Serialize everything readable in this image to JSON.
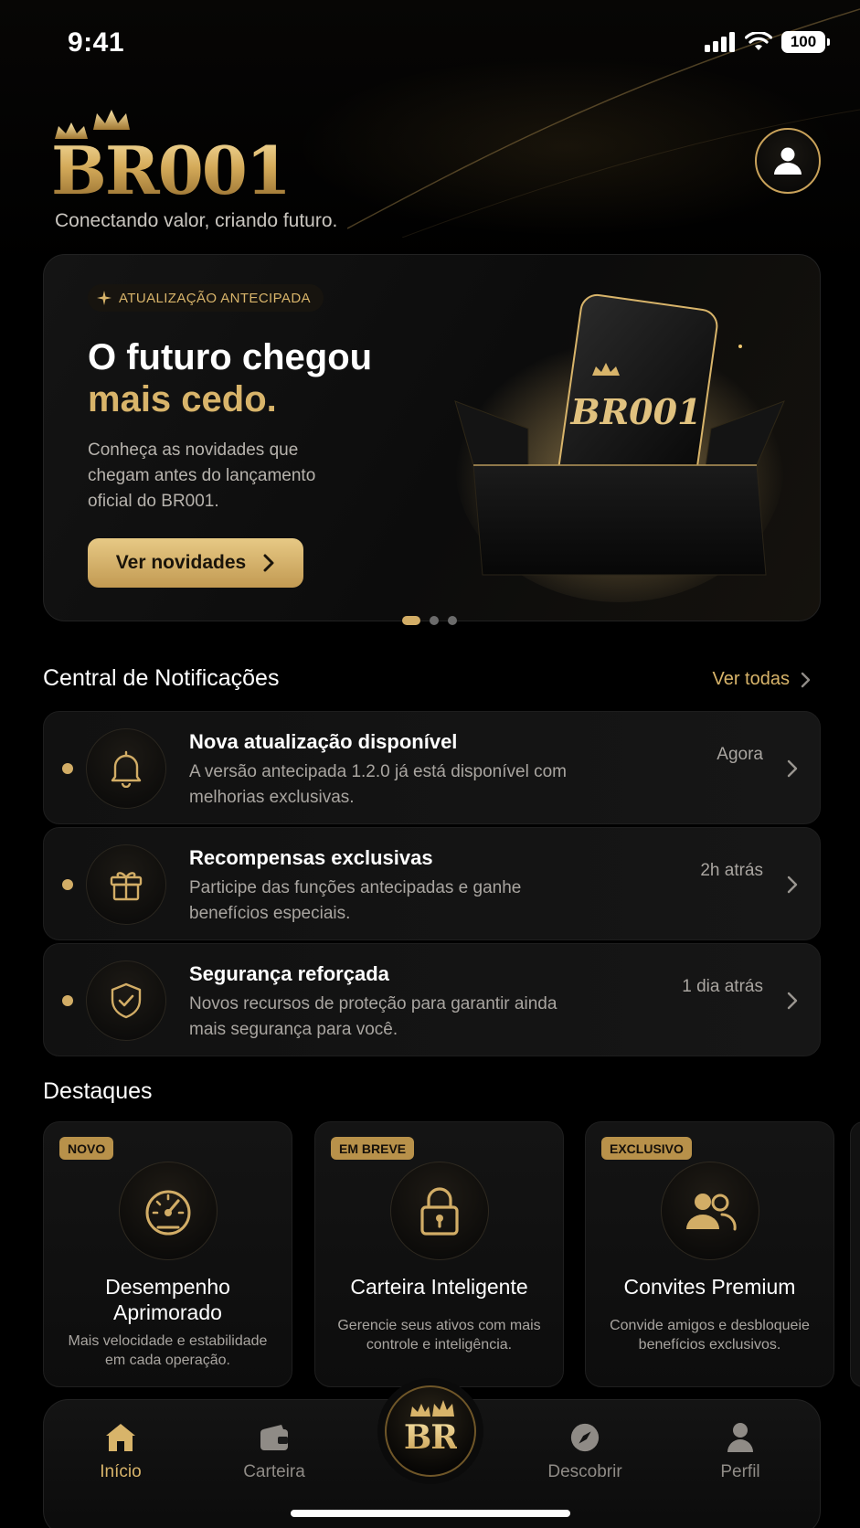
{
  "status_bar": {
    "time": "9:41",
    "battery": "100"
  },
  "header": {
    "logo_text": "BR001",
    "tagline": "Conectando valor, criando futuro."
  },
  "hero": {
    "chip": "ATUALIZAÇÃO ANTECIPADA",
    "title_line1": "O futuro chegou",
    "title_line2": "mais cedo.",
    "description": "Conheça as novidades que chegam antes do lançamento oficial do BR001.",
    "button_label": "Ver novidades",
    "art_logo": "BR001",
    "carousel_total": 3,
    "carousel_active": 1
  },
  "notifications": {
    "title": "Central de Notificações",
    "see_all": "Ver todas",
    "items": [
      {
        "icon": "bell-icon",
        "title": "Nova atualização disponível",
        "desc": "A versão antecipada 1.2.0 já está disponível com melhorias exclusivas.",
        "time": "Agora"
      },
      {
        "icon": "gift-icon",
        "title": "Recompensas exclusivas",
        "desc": "Participe das funções antecipadas e ganhe benefícios especiais.",
        "time": "2h atrás"
      },
      {
        "icon": "shield-check-icon",
        "title": "Segurança reforçada",
        "desc": "Novos recursos de proteção para garantir ainda mais segurança para você.",
        "time": "1 dia atrás"
      }
    ]
  },
  "highlights": {
    "title": "Destaques",
    "cards": [
      {
        "badge": "NOVO",
        "icon": "speedometer-icon",
        "title": "Desempenho Aprimorado",
        "desc": "Mais velocidade e estabilidade em cada operação."
      },
      {
        "badge": "EM BREVE",
        "icon": "lock-icon",
        "title": "Carteira Inteligente",
        "desc": "Gerencie seus ativos com mais controle e inteligência."
      },
      {
        "badge": "EXCLUSIVO",
        "icon": "users-icon",
        "title": "Convites Premium",
        "desc": "Convide amigos e desbloqueie benefícios exclusivos."
      }
    ]
  },
  "tabbar": {
    "center_label": "BR",
    "tabs": [
      {
        "label": "Início",
        "icon": "home-icon",
        "active": true
      },
      {
        "label": "Carteira",
        "icon": "wallet-icon",
        "active": false
      },
      {
        "label": "Descobrir",
        "icon": "compass-icon",
        "active": false
      },
      {
        "label": "Perfil",
        "icon": "person-icon",
        "active": false
      }
    ]
  },
  "colors": {
    "gold": "#d8b46a",
    "background": "#000000",
    "card": "#121212",
    "muted": "#a9a5a0"
  }
}
